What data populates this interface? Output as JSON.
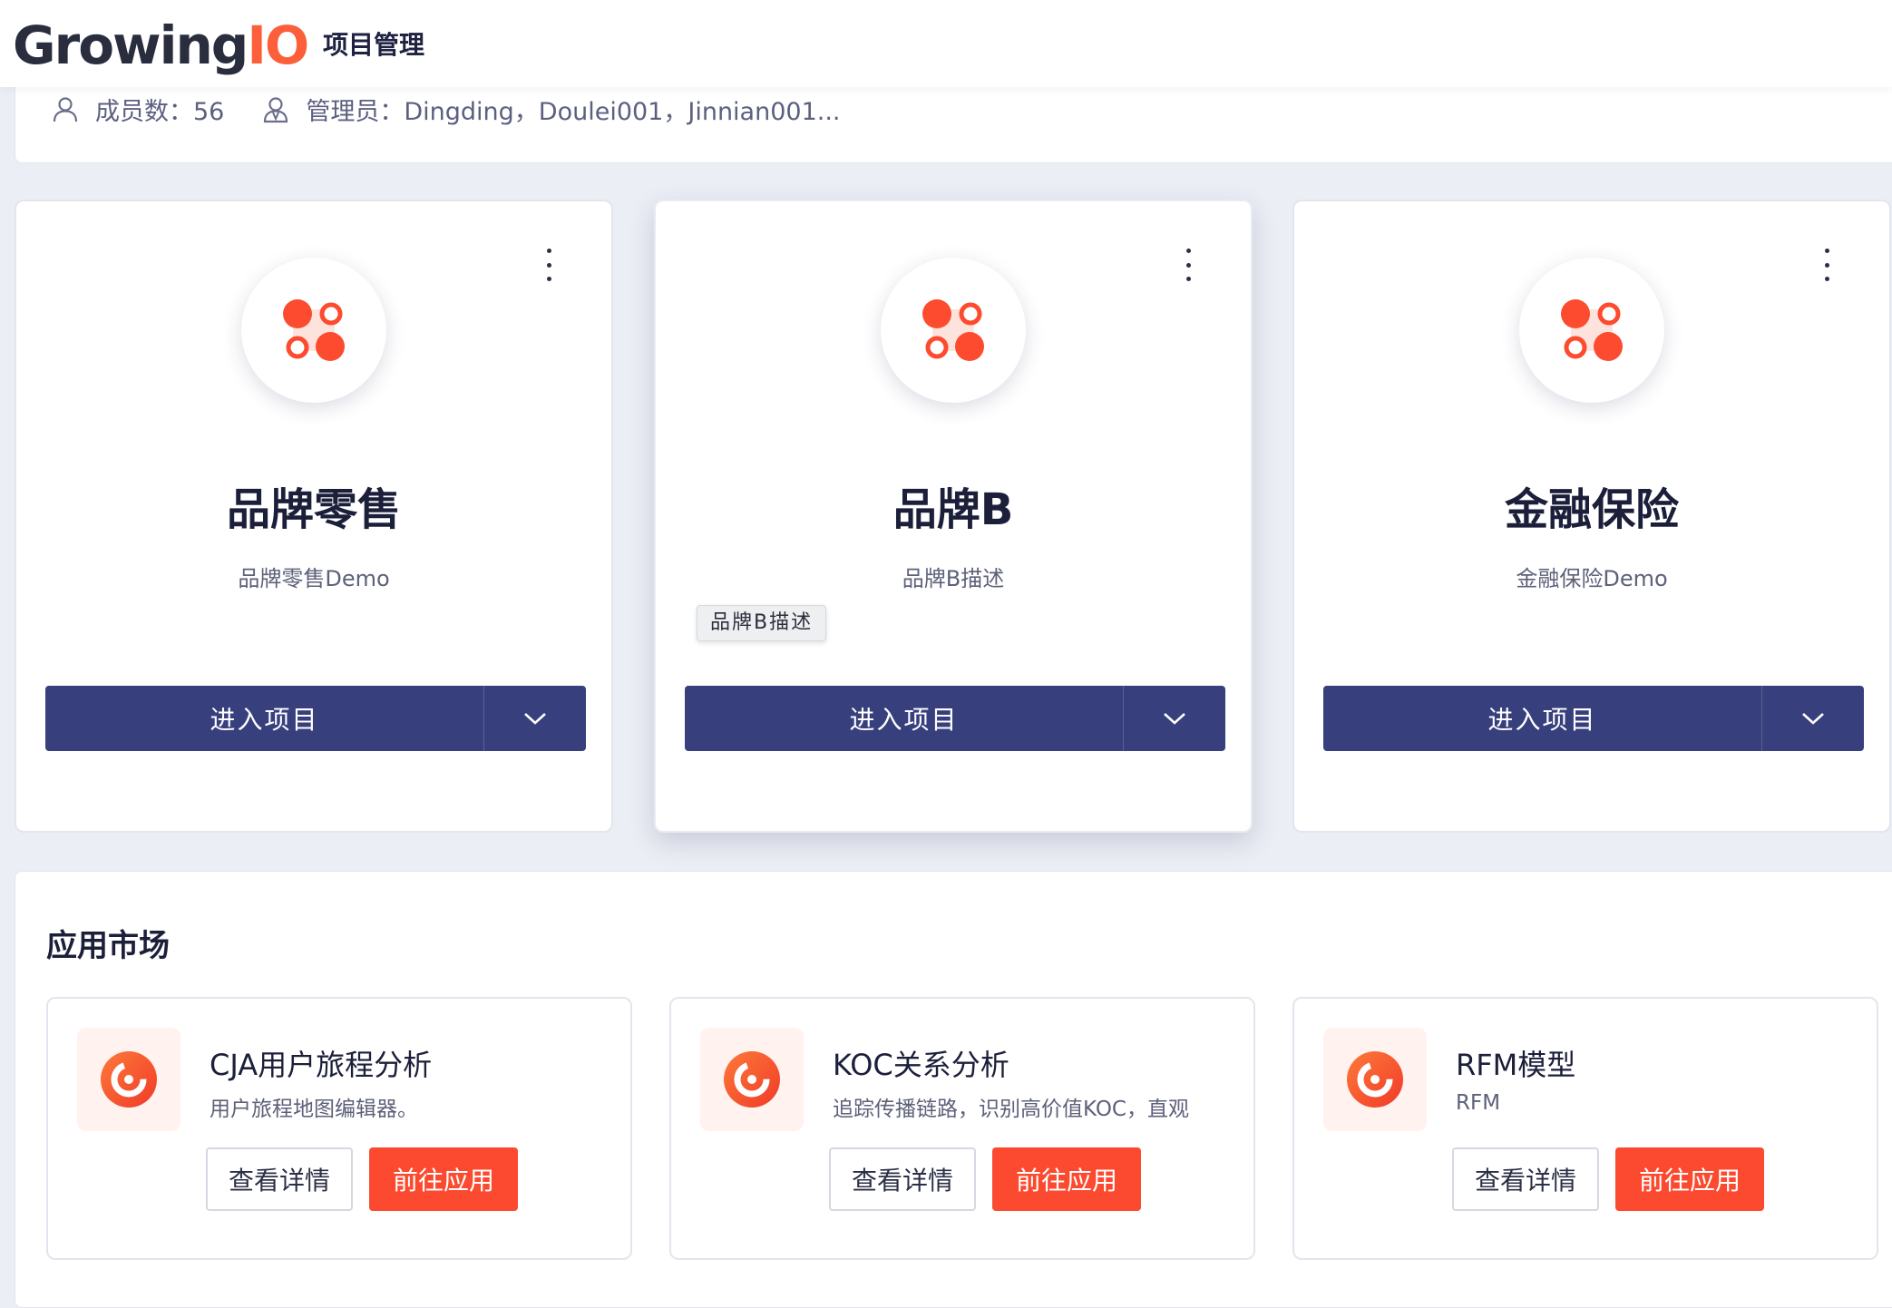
{
  "header": {
    "logo_main": "Growing",
    "logo_accent": "IO",
    "nav_title": "项目管理"
  },
  "info": {
    "members": "成员数：56",
    "admins": "管理员：Dingding，Doulei001，Jinnian001..."
  },
  "projects": [
    {
      "name": "品牌零售",
      "desc": "品牌零售Demo",
      "enter_label": "进入项目"
    },
    {
      "name": "品牌B",
      "desc": "品牌B描述",
      "enter_label": "进入项目"
    },
    {
      "name": "金融保险",
      "desc": "金融保险Demo",
      "enter_label": "进入项目"
    }
  ],
  "tooltip": "品牌B描述",
  "market": {
    "title": "应用市场",
    "apps": [
      {
        "title": "CJA用户旅程分析",
        "sub": "用户旅程地图编辑器。",
        "detail_label": "查看详情",
        "go_label": "前往应用"
      },
      {
        "title": "KOC关系分析",
        "sub": "追踪传播链路，识别高价值KOC，直观",
        "detail_label": "查看详情",
        "go_label": "前往应用"
      },
      {
        "title": "RFM模型",
        "sub": "RFM",
        "detail_label": "查看详情",
        "go_label": "前往应用"
      }
    ]
  },
  "colors": {
    "primary": "#373f7d",
    "accent": "#fb4a2f",
    "logo_dark": "#2a2d3e"
  }
}
